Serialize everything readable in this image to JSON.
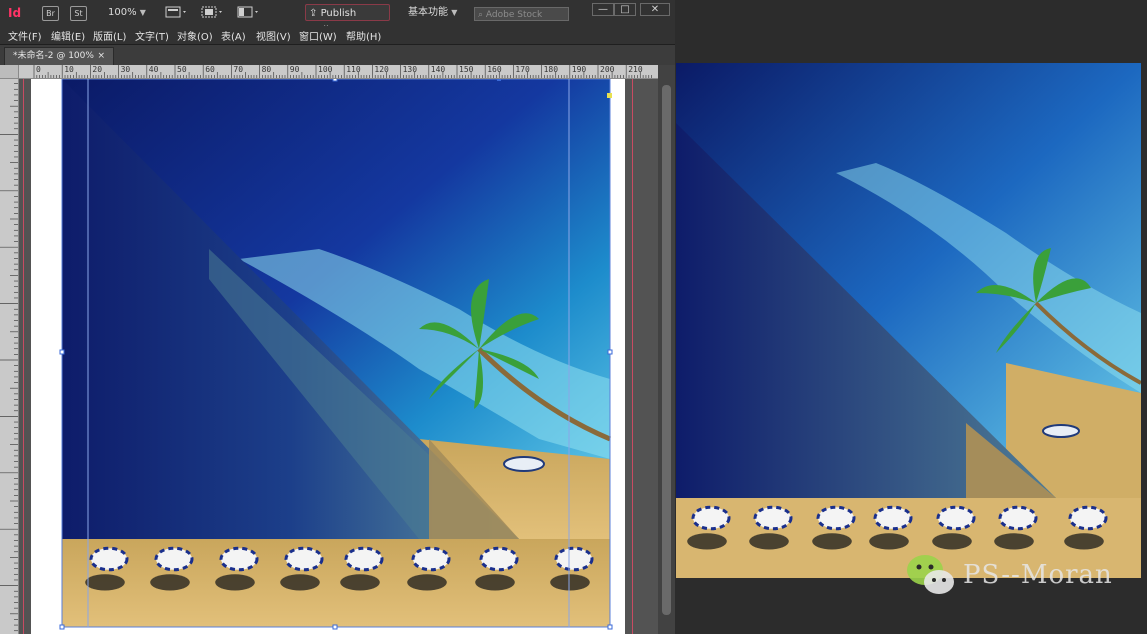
{
  "app": {
    "logo": "Id",
    "bridge_badge": "Br",
    "stock_badge": "St",
    "zoom": "100%",
    "publish_label": "Publish Online",
    "workspace_label": "基本功能",
    "stock_search_placeholder": "Adobe Stock",
    "window_controls": {
      "minimize": "—",
      "maximize": "□",
      "close": "✕"
    }
  },
  "menu": [
    "文件(F)",
    "编辑(E)",
    "版面(L)",
    "文字(T)",
    "对象(O)",
    "表(A)",
    "视图(V)",
    "窗口(W)",
    "帮助(H)"
  ],
  "document_tab": {
    "title": "*未命名-2 @ 100%",
    "close": "×"
  },
  "ruler": {
    "labels": [
      "0",
      "10",
      "20",
      "30",
      "40",
      "50",
      "60",
      "70",
      "80",
      "90",
      "100",
      "110",
      "120",
      "130",
      "140",
      "150",
      "160",
      "170",
      "180",
      "190",
      "200",
      "210"
    ]
  },
  "watermark": {
    "text": "PS--Moran",
    "icon": "wechat-icon"
  },
  "colors": {
    "accent": "#ff3366",
    "ocean_deep": "#0e1f6e",
    "ocean_light": "#28a8d8",
    "sand": "#d6b46a"
  }
}
